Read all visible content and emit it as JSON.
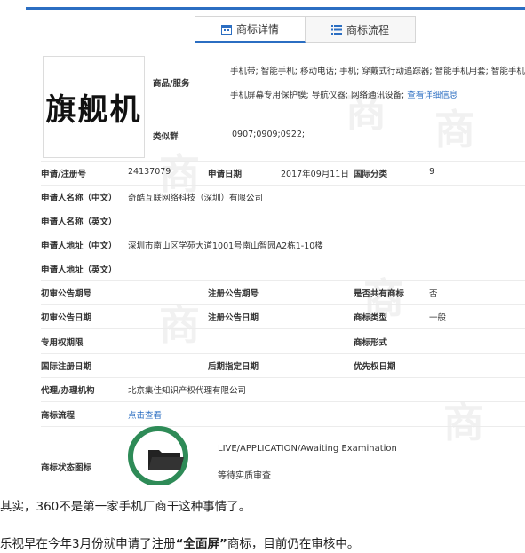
{
  "tabs": [
    {
      "label": "商标详情",
      "icon": "calendar-icon"
    },
    {
      "label": "商标流程",
      "icon": "list-icon"
    }
  ],
  "logo_text": "旗舰机",
  "goods_services": {
    "label": "商品/服务",
    "line1": "手机带; 智能手机; 移动电话; 手机; 穿戴式行动追踪器; 智能手机用套; 智能手机用壳",
    "line2_prefix": "手机屏幕专用保护膜; 导航仪器; 网络通讯设备;",
    "detail_link": "查看详细信息"
  },
  "similar_group": {
    "label": "类似群",
    "value": "0907;0909;0922;"
  },
  "fields": {
    "reg_no_label": "申请/注册号",
    "reg_no": "24137079",
    "apply_date_label": "申请日期",
    "apply_date": "2017年09月11日",
    "intl_class_label": "国际分类",
    "intl_class": "9",
    "applicant_cn_label": "申请人名称（中文）",
    "applicant_cn": "奇酷互联网络科技（深圳）有限公司",
    "applicant_en_label": "申请人名称（英文）",
    "address_cn_label": "申请人地址（中文）",
    "address_cn": "深圳市南山区学苑大道1001号南山智园A2栋1-10楼",
    "address_en_label": "申请人地址（英文）",
    "prelim_no_label": "初审公告期号",
    "reg_notice_no_label": "注册公告期号",
    "shared_label": "是否共有商标",
    "shared": "否",
    "prelim_date_label": "初审公告日期",
    "reg_notice_date_label": "注册公告日期",
    "mark_type_label": "商标类型",
    "mark_type": "一般",
    "exclusive_period_label": "专用权期限",
    "mark_form_label": "商标形式",
    "intl_reg_date_label": "国际注册日期",
    "later_date_label": "后期指定日期",
    "priority_date_label": "优先权日期",
    "agent_label": "代理/办理机构",
    "agent": "北京集佳知识产权代理有限公司",
    "process_label": "商标流程",
    "process_link": "点击查看",
    "status_label": "商标状态图标",
    "status_text": "LIVE/APPLICATION/Awaiting Examination",
    "status_sub": "等待实质审查"
  },
  "watermark_char": "商",
  "paragraphs": {
    "p1": "其实，360不是第一家手机厂商干这种事情了。",
    "p2_a": "乐视早在今年3月份就申请了注册",
    "p2_b": "“全面屏”",
    "p2_c": "商标，目前仍在审核中。"
  },
  "colors": {
    "accent": "#2b6ec2",
    "status_green": "#2e8b57"
  }
}
